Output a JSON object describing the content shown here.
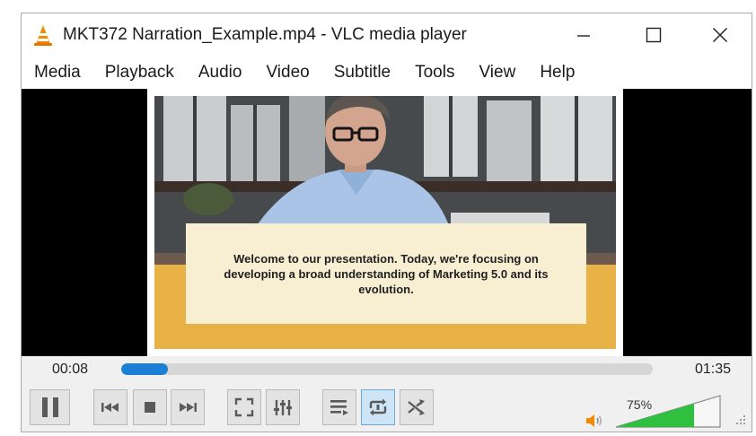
{
  "window": {
    "title": "MKT372 Narration_Example.mp4 - VLC media player",
    "app_icon": "vlc-cone-icon"
  },
  "menu": {
    "items": [
      "Media",
      "Playback",
      "Audio",
      "Video",
      "Subtitle",
      "Tools",
      "View",
      "Help"
    ]
  },
  "video": {
    "caption": "Welcome to our presentation. Today, we're focusing on developing a broad understanding of Marketing 5.0 and its evolution."
  },
  "playback": {
    "elapsed": "00:08",
    "total": "01:35",
    "progress_fraction": 0.085
  },
  "controls": {
    "buttons": [
      "pause",
      "previous",
      "stop",
      "next",
      "fullscreen",
      "extended-settings",
      "playlist",
      "loop",
      "shuffle"
    ],
    "loop_active": true
  },
  "volume": {
    "label": "75%",
    "level_fraction": 0.75
  },
  "colors": {
    "accent": "#1c7fd6",
    "volume_fill": "#2fc040",
    "caption_bg": "#f8efd3",
    "banner_yellow": "#e9b246",
    "vlc_orange": "#f08a00"
  }
}
